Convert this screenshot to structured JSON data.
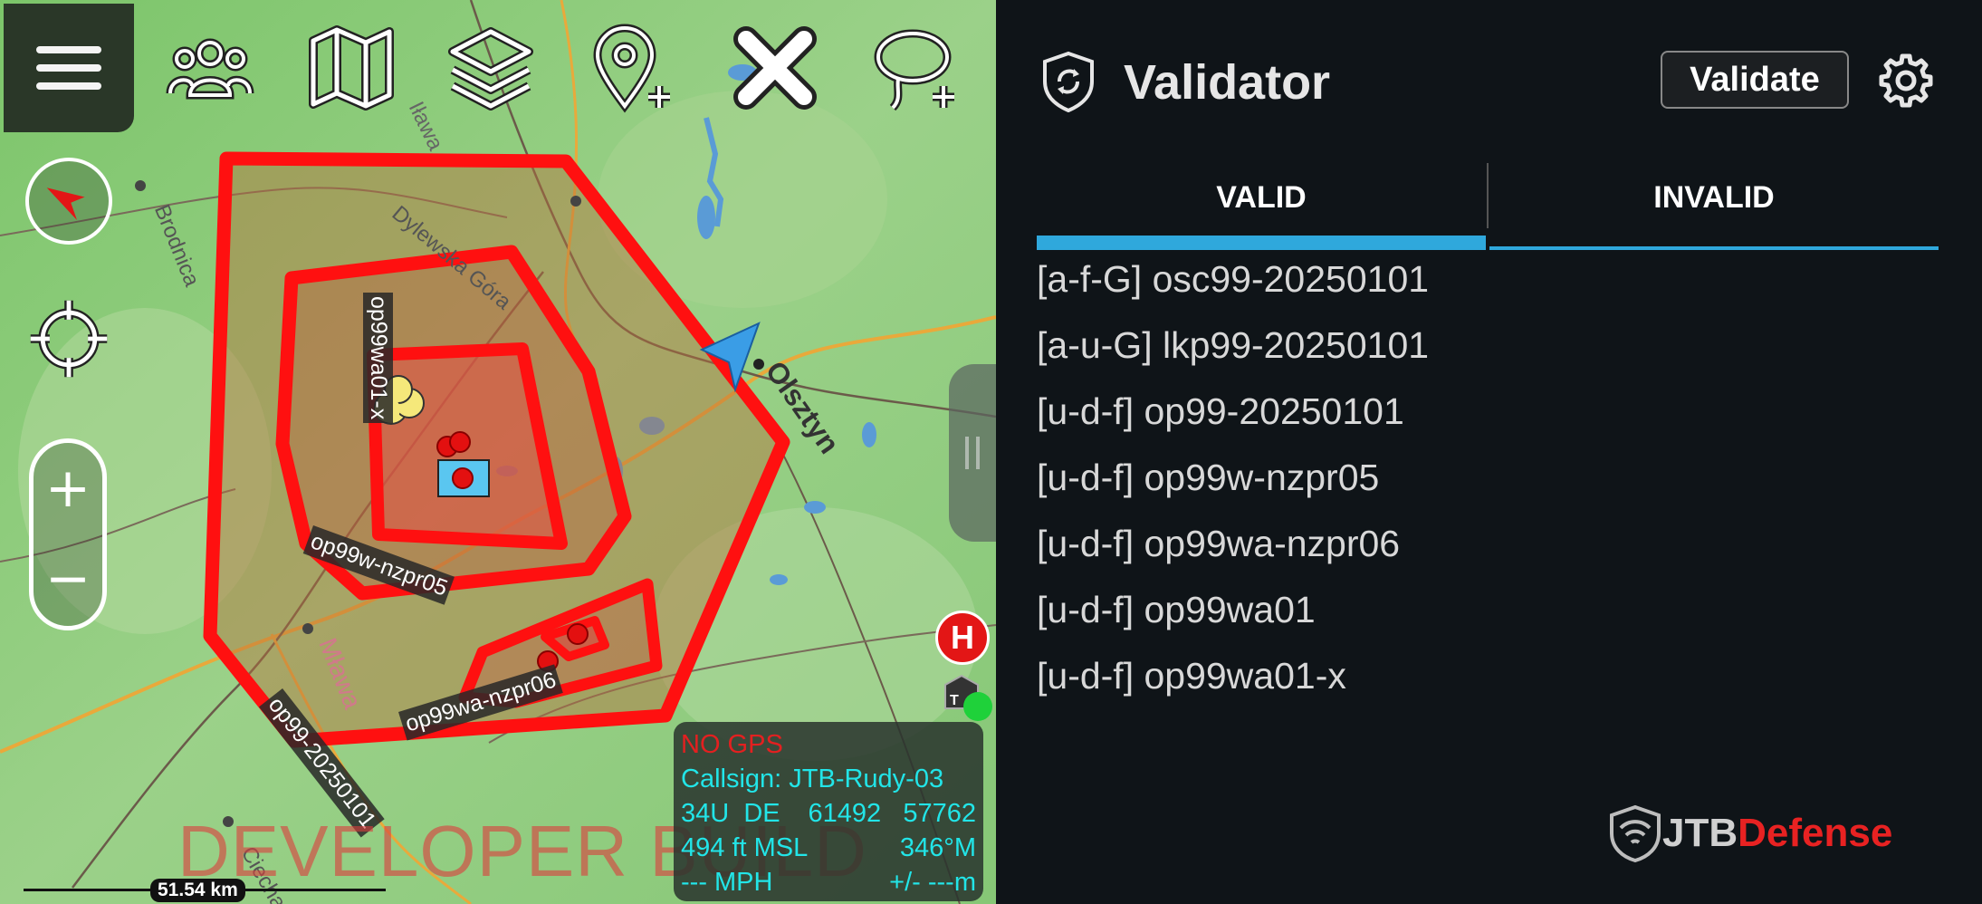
{
  "toolbar": {
    "menu_icon": "hamburger-menu-icon",
    "icons": [
      "contacts-icon",
      "map-icon",
      "layers-icon",
      "add-point-icon",
      "close-icon",
      "add-lasso-icon"
    ]
  },
  "map": {
    "labels": {
      "op99wa01x": "op99wa01-x",
      "nzpr05": "op99w-nzpr05",
      "nzpr06": "op99wa-nzpr06",
      "op99": "op99-20250101"
    },
    "places": {
      "ilawa": "Iława",
      "brodnica": "Brodnica",
      "dylewska": "Dylewska Góra",
      "olsztyn": "Olsztyn",
      "mlawa": "Mława",
      "ciechanow": "Ciechanów"
    },
    "developer_build": "DEVELOPER BUILD",
    "scale": "51.54 km",
    "h_button": "H",
    "tac_label": "T"
  },
  "status": {
    "gps": "NO GPS",
    "callsign": "Callsign: JTB-Rudy-03",
    "grid_zone": "34U",
    "grid_square": "DE",
    "easting": "61492",
    "northing": "57762",
    "altitude": "494 ft MSL",
    "heading": "346°M",
    "speed": "--- MPH",
    "accuracy": "+/- ---m"
  },
  "panel": {
    "title": "Validator",
    "validate_label": "Validate",
    "tabs": {
      "valid": "VALID",
      "invalid": "INVALID"
    },
    "items": [
      "[a-f-G] osc99-20250101",
      "[a-u-G] lkp99-20250101",
      "[u-d-f] op99-20250101",
      "[u-d-f] op99w-nzpr05",
      "[u-d-f] op99wa-nzpr06",
      "[u-d-f] op99wa01",
      "[u-d-f] op99wa01-x"
    ],
    "brand_a": "JTB",
    "brand_b": "Defense"
  },
  "colors": {
    "accent": "#2fa8dc",
    "polygon": "#ff1010",
    "map_green": "#8ccb78",
    "status_text": "#22e5e8",
    "no_gps": "#e32020"
  }
}
